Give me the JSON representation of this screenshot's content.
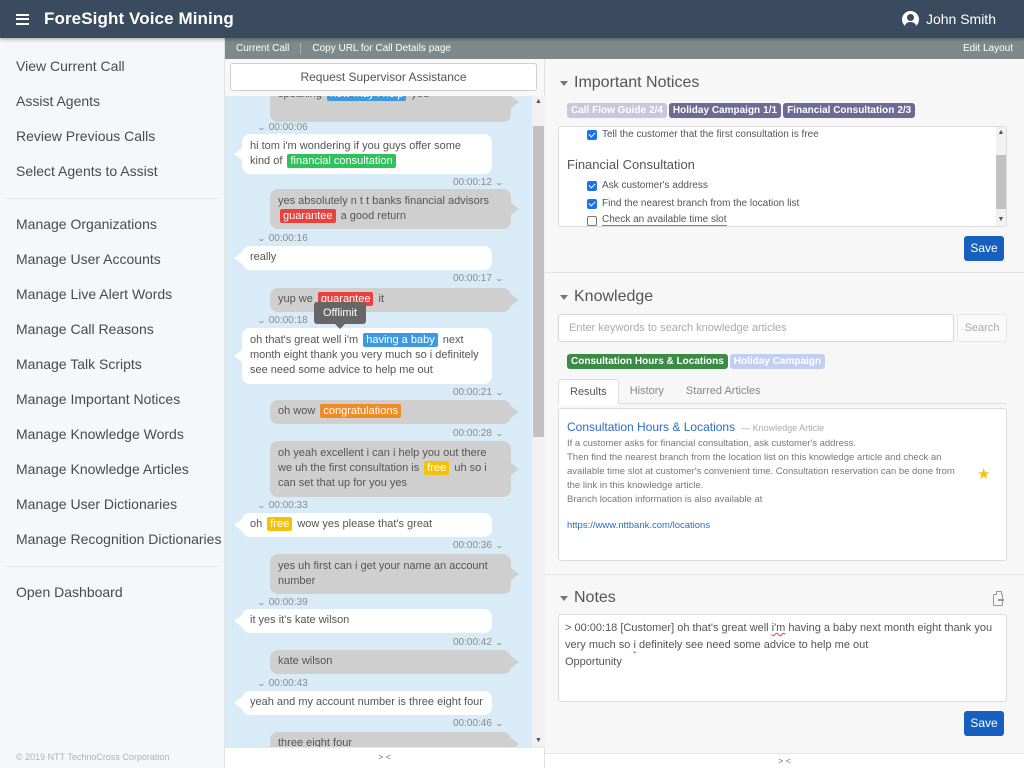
{
  "app": {
    "title": "ForeSight Voice Mining",
    "user": "John Smith"
  },
  "sidebar": {
    "group1": [
      "View Current Call",
      "Assist Agents",
      "Review Previous Calls",
      "Select Agents to Assist"
    ],
    "group2": [
      "Manage Organizations",
      "Manage User Accounts",
      "Manage Live Alert Words",
      "Manage Call Reasons",
      "Manage Talk Scripts",
      "Manage Important Notices",
      "Manage Knowledge Words",
      "Manage Knowledge Articles",
      "Manage User Dictionaries",
      "Manage Recognition Dictionaries"
    ],
    "group3": [
      "Open Dashboard"
    ],
    "copyright": "© 2019 NTT TechnoCross Corporation"
  },
  "toolbar": {
    "current_call": "Current Call",
    "copy_url": "Copy URL for Call Details page",
    "edit_layout": "Edit Layout"
  },
  "transcript": {
    "request_button": "Request Supervisor Assistance",
    "tooltip": "Offlimit",
    "collapse": "> <",
    "messages": [
      {
        "speaker": "agent",
        "time": "",
        "parts": [
          [
            "speaking "
          ],
          [
            "how may i help",
            "blue"
          ],
          [
            " you"
          ]
        ]
      },
      {
        "speaker": "customer",
        "time": "00:00:06",
        "parts": [
          [
            "hi tom i'm wondering if you guys offer some kind of "
          ],
          [
            "financial consultation",
            "green"
          ]
        ]
      },
      {
        "speaker": "agent",
        "time": "00:00:12",
        "parts": [
          [
            "yes absolutely n t t banks financial advisors "
          ],
          [
            "guarantee",
            "red"
          ],
          [
            " a good return"
          ]
        ]
      },
      {
        "speaker": "customer",
        "time": "00:00:16",
        "parts": [
          [
            "really"
          ]
        ]
      },
      {
        "speaker": "agent",
        "time": "00:00:17",
        "parts": [
          [
            "yup we "
          ],
          [
            "guarantee",
            "red"
          ],
          [
            " it"
          ]
        ]
      },
      {
        "speaker": "customer",
        "time": "00:00:18",
        "parts": [
          [
            "oh that's great well i'm "
          ],
          [
            "having a baby",
            "blue"
          ],
          [
            " next month eight thank you very much so i definitely see need some advice to help me out"
          ]
        ]
      },
      {
        "speaker": "agent",
        "time": "00:00:21",
        "parts": [
          [
            "oh wow "
          ],
          [
            "congratulations",
            "orange"
          ]
        ]
      },
      {
        "speaker": "agent",
        "time": "00:00:28",
        "parts": [
          [
            "oh yeah excellent i can i help you out there we uh the first consultation is "
          ],
          [
            "free",
            "yellow"
          ],
          [
            " uh so i can set that up for you yes"
          ]
        ]
      },
      {
        "speaker": "customer",
        "time": "00:00:33",
        "parts": [
          [
            "oh "
          ],
          [
            "free",
            "yellow"
          ],
          [
            " wow yes please that's great"
          ]
        ]
      },
      {
        "speaker": "agent",
        "time": "00:00:36",
        "parts": [
          [
            "yes uh first can i get your name an account number"
          ]
        ]
      },
      {
        "speaker": "customer",
        "time": "00:00:39",
        "parts": [
          [
            "it yes it's kate wilson"
          ]
        ]
      },
      {
        "speaker": "agent",
        "time": "00:00:42",
        "parts": [
          [
            "kate wilson"
          ]
        ]
      },
      {
        "speaker": "customer",
        "time": "00:00:43",
        "parts": [
          [
            "yeah and my account number is three eight four"
          ]
        ]
      },
      {
        "speaker": "agent",
        "time": "00:00:46",
        "parts": [
          [
            "three eight four"
          ]
        ]
      }
    ]
  },
  "keyword_colors": {
    "blue": "#3d9ae0",
    "green": "#2fc25b",
    "red": "#e8413e",
    "orange": "#f08a24",
    "yellow": "#f4c20d"
  },
  "notices": {
    "title": "Important Notices",
    "tags": [
      {
        "label": "Call Flow Guide",
        "count": "2/4",
        "style": "light"
      },
      {
        "label": "Holiday Campaign",
        "count": "1/1",
        "style": "purple"
      },
      {
        "label": "Financial Consultation",
        "count": "2/3",
        "style": "purple"
      }
    ],
    "items_top": [
      {
        "text": "Tell the customer that the first consultation is free",
        "checked": true
      }
    ],
    "group_heading": "Financial Consultation",
    "items": [
      {
        "text": "Ask customer's address",
        "checked": true
      },
      {
        "text": "Find the nearest branch from the location list",
        "checked": true
      },
      {
        "text": "Check an available time slot",
        "checked": false
      }
    ],
    "save": "Save"
  },
  "knowledge": {
    "title": "Knowledge",
    "search_placeholder": "Enter keywords to search knowledge articles",
    "search_button": "Search",
    "tags": [
      {
        "label": "Consultation Hours & Locations",
        "style": "green"
      },
      {
        "label": "Holiday Campaign",
        "style": "lightblue"
      }
    ],
    "tabs": [
      "Results",
      "History",
      "Starred Articles"
    ],
    "active_tab": "Results",
    "article": {
      "title": "Consultation Hours & Locations",
      "type": "— Knowledge Article",
      "body": [
        "If a customer asks for financial consultation, ask customer's address.",
        "Then find the nearest branch from the location list on this knowledge article and check an available time slot at customer's convenient time. Consultation reservation can be done from the link in this knowledge article.",
        "Branch location information is also available at"
      ],
      "link": "https://www.nttbank.com/locations",
      "starred": true
    }
  },
  "notes": {
    "title": "Notes",
    "line1_pre": "> 00:00:18 [Customer] oh that's great well ",
    "line1_spell": "i'm",
    "line1_post": " having a baby next month eight thank you very much so ",
    "line2_spell": "i",
    "line2_post": " definitely see need some advice to help me out",
    "line3": "Opportunity",
    "save": "Save",
    "collapse": "> <"
  }
}
